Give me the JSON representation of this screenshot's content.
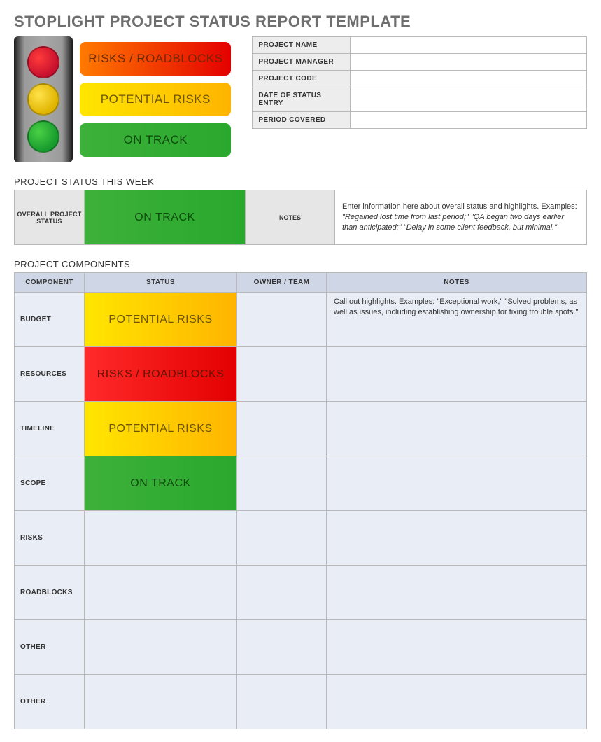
{
  "title": "STOPLIGHT PROJECT STATUS REPORT TEMPLATE",
  "legend": {
    "red": "RISKS / ROADBLOCKS",
    "yellow": "POTENTIAL RISKS",
    "green": "ON TRACK"
  },
  "meta": {
    "rows": [
      {
        "k": "PROJECT NAME",
        "v": ""
      },
      {
        "k": "PROJECT MANAGER",
        "v": ""
      },
      {
        "k": "PROJECT CODE",
        "v": ""
      },
      {
        "k": "DATE OF STATUS ENTRY",
        "v": ""
      },
      {
        "k": "PERIOD COVERED",
        "v": ""
      }
    ]
  },
  "status_week": {
    "heading": "PROJECT STATUS THIS WEEK",
    "overall_label": "OVERALL PROJECT STATUS",
    "overall_status": {
      "text": "ON TRACK",
      "tone": "green"
    },
    "notes_label": "NOTES",
    "notes_intro": "Enter information here about overall status and highlights. Examples: ",
    "notes_examples": "\"Regained lost time from last period;\" \"QA began two days earlier than anticipated;\" \"Delay in some client feedback, but minimal.\""
  },
  "components": {
    "heading": "PROJECT COMPONENTS",
    "columns": [
      "COMPONENT",
      "STATUS",
      "OWNER / TEAM",
      "NOTES"
    ],
    "rows": [
      {
        "name": "BUDGET",
        "status": {
          "text": "POTENTIAL RISKS",
          "tone": "yellow"
        },
        "owner": "",
        "notes": "Call out highlights. Examples: \"Exceptional work,\" \"Solved problems, as well as issues, including establishing ownership for fixing trouble spots.\""
      },
      {
        "name": "RESOURCES",
        "status": {
          "text": "RISKS / ROADBLOCKS",
          "tone": "red"
        },
        "owner": "",
        "notes": ""
      },
      {
        "name": "TIMELINE",
        "status": {
          "text": "POTENTIAL RISKS",
          "tone": "yellow"
        },
        "owner": "",
        "notes": ""
      },
      {
        "name": "SCOPE",
        "status": {
          "text": "ON TRACK",
          "tone": "green"
        },
        "owner": "",
        "notes": ""
      },
      {
        "name": "RISKS",
        "status": null,
        "owner": "",
        "notes": ""
      },
      {
        "name": "ROADBLOCKS",
        "status": null,
        "owner": "",
        "notes": ""
      },
      {
        "name": "OTHER",
        "status": null,
        "owner": "",
        "notes": ""
      },
      {
        "name": "OTHER",
        "status": null,
        "owner": "",
        "notes": ""
      }
    ]
  }
}
